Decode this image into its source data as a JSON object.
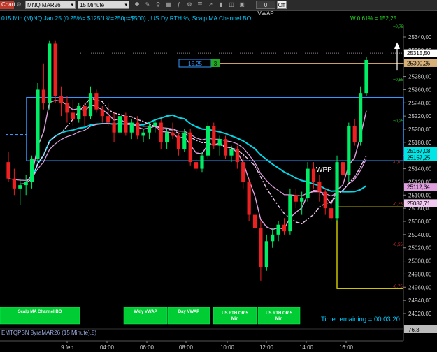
{
  "toolbar": {
    "chart_label": "Chart",
    "instrument": "MNQ MAR26",
    "interval": "15 Minute",
    "vwap_button": "0 VWAP",
    "off_toggle": "Off"
  },
  "header": {
    "title": "015 Min (M)NQ Jan 25  (0.25%= $125/1%=250p=$500) , US Dy RTH %, Scalp MA Channel BO",
    "w_stat": "W 0,61% = 152,25"
  },
  "box_label": {
    "value": "15,25",
    "tag": "3"
  },
  "wpp_label": "WPP",
  "time_remaining": "Time remaining = 00:03:20",
  "bottom_buttons": [
    {
      "label": "Scalp MA Channel BO"
    },
    {
      "label": "Wkly VWAP"
    },
    {
      "label": "Day VWAP"
    },
    {
      "label": "US ETH OR 5 Min"
    },
    {
      "label": "US RTH OR 5 Min"
    }
  ],
  "footer_text": "EMTQPSN 8yraMAR26 (15 Minute),8)",
  "indicator_value": "76,3",
  "price_axis": {
    "ticks": [
      "25340,00",
      "25320,00",
      "25300,00",
      "25280,00",
      "25260,00",
      "25240,00",
      "25220,00",
      "25200,00",
      "25180,00",
      "25160,00",
      "25140,00",
      "25120,00",
      "25100,00",
      "25080,00",
      "25060,00",
      "25040,00",
      "25020,00",
      "25000,00",
      "24980,00",
      "24960,00",
      "24940,00",
      "24920,00"
    ],
    "tags": [
      {
        "value": "25315,50",
        "bg": "#ffffff",
        "fg": "#000000"
      },
      {
        "value": "25300,25",
        "bg": "#d8b07a",
        "fg": "#000000"
      },
      {
        "value": "25167,08",
        "bg": "#00e5e5",
        "fg": "#000000"
      },
      {
        "value": "25157,25",
        "bg": "#00e5e5",
        "fg": "#000000"
      },
      {
        "value": "25112,34",
        "bg": "#e0a0e0",
        "fg": "#000000"
      },
      {
        "value": "25087,71",
        "bg": "#f0c8f0",
        "fg": "#000000"
      }
    ]
  },
  "pct_labels": [
    {
      "value": "+0,75",
      "color": "#22cc22"
    },
    {
      "value": "+0,55",
      "color": "#22cc22"
    },
    {
      "value": "+0,25",
      "color": "#22cc22"
    },
    {
      "value": "-0,0",
      "color": "#cc3333"
    },
    {
      "value": "-0,25",
      "color": "#cc3333"
    },
    {
      "value": "-0,55",
      "color": "#cc3333"
    },
    {
      "value": "-0,75",
      "color": "#cc3333"
    }
  ],
  "time_axis": {
    "labels": [
      "9 feb",
      "04:00",
      "06:00",
      "08:00",
      "10:00",
      "12:00",
      "14:00",
      "16:00"
    ]
  },
  "colors": {
    "bull": "#00ee66",
    "bear": "#ee2020",
    "cyan": "#00d8e8",
    "pink": "#e0a0e0",
    "box": "#3399ff",
    "yellow": "#e8e000"
  },
  "chart_data": {
    "type": "candlestick",
    "ylim": [
      24910,
      25350
    ],
    "candles": [
      [
        25150,
        25165,
        25120,
        25125
      ],
      [
        25125,
        25140,
        25100,
        25110
      ],
      [
        25110,
        25125,
        25085,
        25115
      ],
      [
        25115,
        25130,
        25100,
        25120
      ],
      [
        25120,
        25160,
        25110,
        25155
      ],
      [
        25155,
        25270,
        25150,
        25260
      ],
      [
        25260,
        25300,
        25230,
        25240
      ],
      [
        25240,
        25335,
        25230,
        25330
      ],
      [
        25330,
        25335,
        25240,
        25250
      ],
      [
        25250,
        25265,
        25220,
        25240
      ],
      [
        25240,
        25250,
        25210,
        25225
      ],
      [
        25225,
        25245,
        25205,
        25215
      ],
      [
        25215,
        25240,
        25210,
        25235
      ],
      [
        25235,
        25240,
        25205,
        25220
      ],
      [
        25220,
        25265,
        25215,
        25255
      ],
      [
        25255,
        25260,
        25225,
        25230
      ],
      [
        25230,
        25235,
        25210,
        25220
      ],
      [
        25220,
        25240,
        25205,
        25210
      ],
      [
        25210,
        25225,
        25180,
        25195
      ],
      [
        25195,
        25225,
        25190,
        25220
      ],
      [
        25220,
        25225,
        25190,
        25195
      ],
      [
        25195,
        25215,
        25185,
        25210
      ],
      [
        25210,
        25220,
        25185,
        25190
      ],
      [
        25190,
        25200,
        25180,
        25195
      ],
      [
        25195,
        25210,
        25185,
        25205
      ],
      [
        25205,
        25215,
        25195,
        25210
      ],
      [
        25210,
        25215,
        25170,
        25180
      ],
      [
        25180,
        25200,
        25170,
        25195
      ],
      [
        25195,
        25210,
        25185,
        25190
      ],
      [
        25190,
        25195,
        25160,
        25170
      ],
      [
        25170,
        25200,
        25165,
        25195
      ],
      [
        25195,
        25200,
        25145,
        25150
      ],
      [
        25150,
        25155,
        25135,
        25140
      ],
      [
        25140,
        25165,
        25135,
        25160
      ],
      [
        25160,
        25210,
        25155,
        25205
      ],
      [
        25205,
        25210,
        25170,
        25175
      ],
      [
        25175,
        25190,
        25160,
        25185
      ],
      [
        25185,
        25190,
        25155,
        25160
      ],
      [
        25160,
        25175,
        25150,
        25170
      ],
      [
        25170,
        25175,
        25140,
        25150
      ],
      [
        25150,
        25160,
        25110,
        25120
      ],
      [
        25120,
        25125,
        25060,
        25070
      ],
      [
        25070,
        25080,
        25040,
        25050
      ],
      [
        25050,
        25060,
        24970,
        24990
      ],
      [
        24990,
        25040,
        24985,
        25030
      ],
      [
        25030,
        25050,
        25020,
        25040
      ],
      [
        25040,
        25060,
        25030,
        25055
      ],
      [
        25055,
        25065,
        25040,
        25045
      ],
      [
        25045,
        25110,
        25040,
        25100
      ],
      [
        25100,
        25110,
        25080,
        25090
      ],
      [
        25090,
        25105,
        25070,
        25095
      ],
      [
        25095,
        25150,
        25090,
        25140
      ],
      [
        25140,
        25150,
        25110,
        25120
      ],
      [
        25120,
        25130,
        25090,
        25105
      ],
      [
        25105,
        25110,
        25070,
        25080
      ],
      [
        25080,
        25090,
        25060,
        25065
      ],
      [
        25065,
        25160,
        25060,
        25150
      ],
      [
        25150,
        25155,
        25120,
        25130
      ],
      [
        25130,
        25210,
        25120,
        25205
      ],
      [
        25205,
        25215,
        25175,
        25180
      ],
      [
        25180,
        25265,
        25175,
        25255
      ],
      [
        25255,
        25310,
        25250,
        25305
      ]
    ]
  }
}
